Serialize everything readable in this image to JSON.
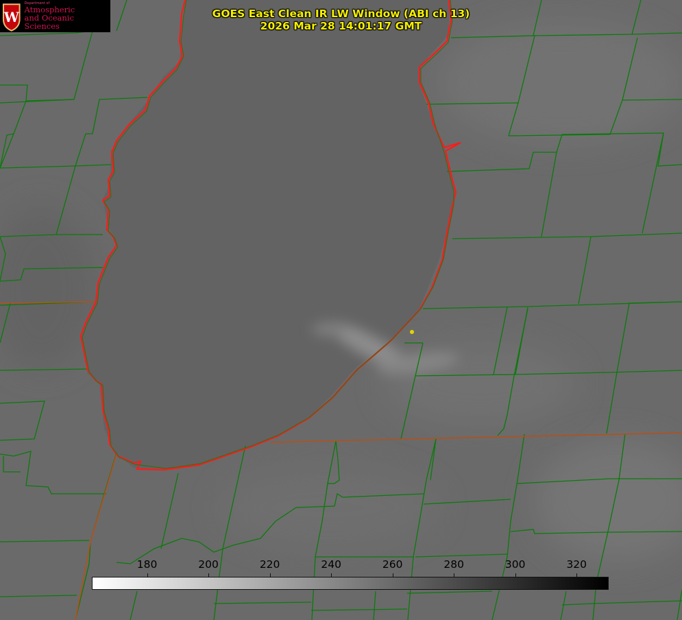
{
  "title": {
    "line1": "GOES East Clean IR LW Window (ABI ch 13)",
    "line2": "2026 Mar 28 14:01:17 GMT"
  },
  "logo": {
    "department": "Department of",
    "line1": "Atmospheric",
    "line2": "and Oceanic Sciences",
    "crest_letter": "W"
  },
  "colorbar": {
    "ticks": [
      "180",
      "200",
      "220",
      "240",
      "260",
      "280",
      "300",
      "320"
    ],
    "range": [
      162,
      330
    ],
    "gradient": [
      "#ffffff",
      "#000000"
    ]
  },
  "colors": {
    "background": "#6b6b6b",
    "county_lines": "#0c7a0c",
    "coastline": "#ff1a1a",
    "title": "#f5f000",
    "marker": "#e3d400",
    "logo_red": "#d4144e"
  },
  "icons": {
    "crest": "uw-crest-icon",
    "marker": "station-dot-icon"
  }
}
